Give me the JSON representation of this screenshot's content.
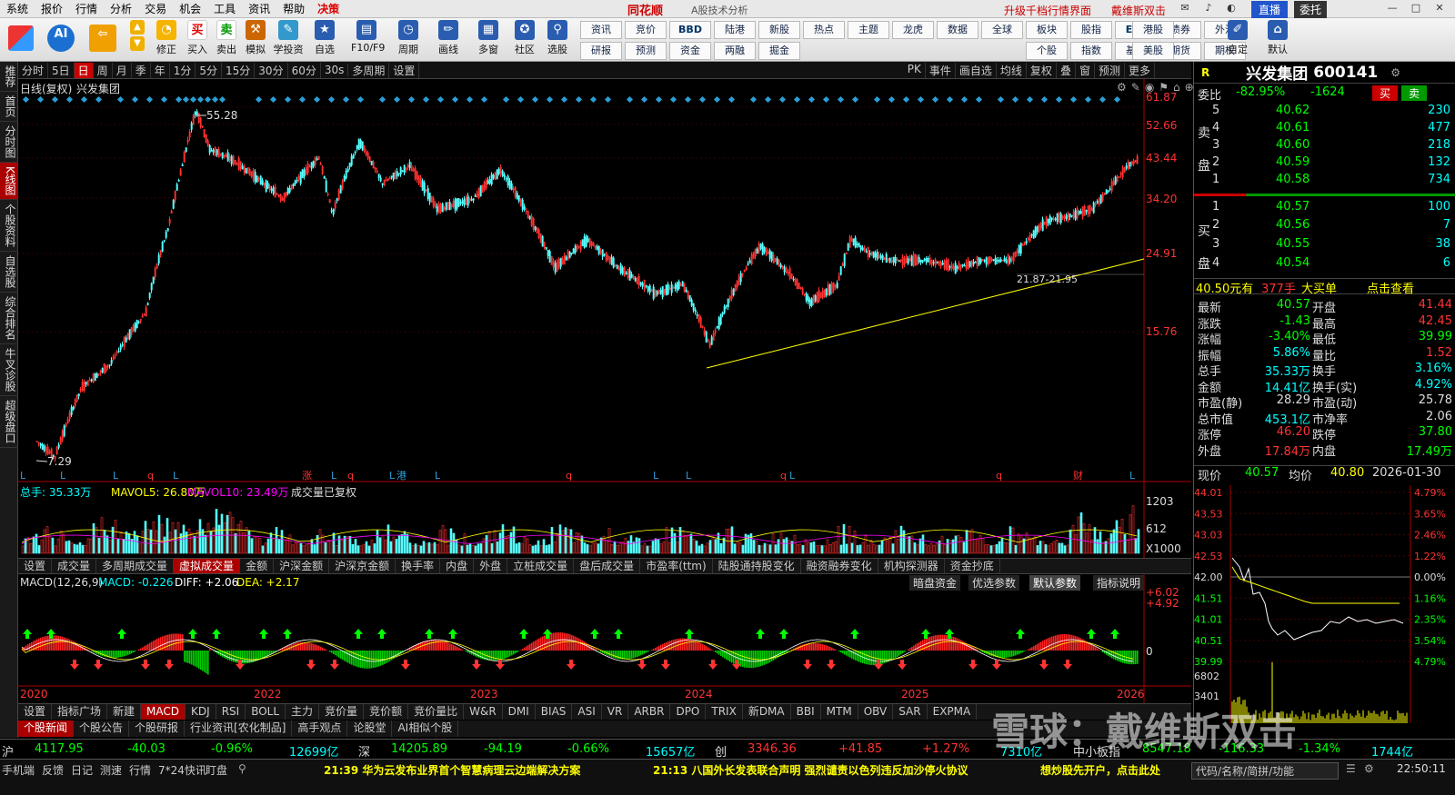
{
  "menu": [
    "系统",
    "报价",
    "行情",
    "分析",
    "交易",
    "机会",
    "工具",
    "资讯",
    "帮助",
    "决策"
  ],
  "app_title": "同花顺",
  "app_subtitle": "A股技术分析",
  "menu_right": {
    "upgrade": "升级千档行情界面",
    "user": "戴维斯双击",
    "zhibo": "直播",
    "weituo": "委托"
  },
  "toolbar_left": [
    "修正",
    "买入",
    "卖出",
    "模拟",
    "学投资",
    "自选",
    "F10/F9",
    "周期",
    "画线",
    "多窗",
    "社区",
    "选股"
  ],
  "toolbar_grid": [
    "资讯",
    "竞价",
    "BBD",
    "陆港",
    "新股",
    "热点",
    "主题",
    "龙虎",
    "数据",
    "全球",
    "板块",
    "股指",
    "ETF",
    "债券",
    "外汇",
    "港股",
    "自定",
    "默认",
    "研报",
    "预测",
    "资金",
    "两融",
    "掘金",
    "个股",
    "指数",
    "基金",
    "期货",
    "期权",
    "美股"
  ],
  "left_side": [
    "推荐",
    "首页",
    "分时图",
    "K线图",
    "个股资料",
    "自选股",
    "综合排名",
    "牛叉诊股",
    "超级盘口"
  ],
  "period_tabs": [
    "分时",
    "5日",
    "日",
    "周",
    "月",
    "季",
    "年",
    "1分",
    "5分",
    "15分",
    "30分",
    "60分",
    "30s",
    "多周期",
    "设置"
  ],
  "right_tabs": [
    "PK",
    "事件",
    "画自选",
    "均线",
    "复权",
    "叠",
    "窗",
    "预测",
    "更多"
  ],
  "chart_header": {
    "type": "日线(复权)",
    "name": "兴发集团"
  },
  "price_axis": [
    "61.87",
    "52.66",
    "43.44",
    "34.20",
    "24.91",
    "15.76"
  ],
  "annotations": {
    "high": "55.28",
    "low": "7.29",
    "range": "21.87-21.95"
  },
  "event_markers": [
    "L",
    "L",
    "L",
    "q",
    "L",
    "涨",
    "L",
    "q",
    "L",
    "港",
    "L",
    "q",
    "L",
    "L",
    "q",
    "L",
    "q",
    "财",
    "L"
  ],
  "volume_header": {
    "total": "总手: 35.33万",
    "mavol5": "MAVOL5: 26.80万",
    "mavol10": "MAVOL10: 23.49万",
    "note": "成交量已复权"
  },
  "volume_axis": [
    "1203",
    "612",
    "X1000"
  ],
  "ind_tabs": [
    "设置",
    "成交量",
    "多周期成交量",
    "虚拟成交量",
    "金额",
    "沪深金额",
    "沪深京金额",
    "换手率",
    "内盘",
    "外盘",
    "立桩成交量",
    "盘后成交量",
    "市盈率(ttm)",
    "陆股通持股变化",
    "融资融券变化",
    "机构探测器",
    "资金抄底"
  ],
  "macd_header": {
    "name": "MACD(12,26,9)",
    "macd": "MACD: -0.226",
    "diff": "DIFF: +2.06",
    "dea": "DEA: +2.17"
  },
  "macd_buttons": [
    "暗盘资金",
    "优选参数",
    "默认参数",
    "指标说明"
  ],
  "macd_axis": [
    "+6.02",
    "+4.92",
    "0"
  ],
  "years": [
    "2020",
    "2022",
    "2023",
    "2024",
    "2025",
    "2026"
  ],
  "ind_tabs2": [
    "设置",
    "指标广场",
    "新建",
    "MACD",
    "KDJ",
    "RSI",
    "BOLL",
    "主力",
    "竞价量",
    "竞价额",
    "竞价量比",
    "W&R",
    "DMI",
    "BIAS",
    "ASI",
    "VR",
    "ARBR",
    "DPO",
    "TRIX",
    "新DMA",
    "BBI",
    "MTM",
    "OBV",
    "SAR",
    "EXPMA"
  ],
  "news_tabs": [
    "个股新闻",
    "个股公告",
    "个股研报",
    "行业资讯[农化制品]",
    "高手观点",
    "论股堂",
    "AI相似个股"
  ],
  "stock": {
    "name": "兴发集团",
    "code": "600141",
    "weibi": "-82.95%",
    "weicha": "-1624",
    "buy_btn": "买",
    "sell_btn": "卖"
  },
  "asks": [
    {
      "lv": "5",
      "p": "40.62",
      "v": "230"
    },
    {
      "lv": "4",
      "p": "40.61",
      "v": "477"
    },
    {
      "lv": "3",
      "p": "40.60",
      "v": "218"
    },
    {
      "lv": "2",
      "p": "40.59",
      "v": "132"
    },
    {
      "lv": "1",
      "p": "40.58",
      "v": "734"
    }
  ],
  "bids": [
    {
      "lv": "1",
      "p": "40.57",
      "v": "100"
    },
    {
      "lv": "2",
      "p": "40.56",
      "v": "7"
    },
    {
      "lv": "3",
      "p": "40.55",
      "v": "38"
    },
    {
      "lv": "4",
      "p": "40.54",
      "v": "6"
    }
  ],
  "big_order": {
    "price": "40.50元有",
    "vol": "377手",
    "label": "大买单",
    "link": "点击查看"
  },
  "quote": [
    [
      "最新",
      "40.57",
      "开盘",
      "41.44"
    ],
    [
      "涨跌",
      "-1.43",
      "最高",
      "42.45"
    ],
    [
      "涨幅",
      "-3.40%",
      "最低",
      "39.99"
    ],
    [
      "振幅",
      "5.86%",
      "量比",
      "1.52"
    ],
    [
      "总手",
      "35.33万",
      "换手",
      "3.16%"
    ],
    [
      "金额",
      "14.41亿",
      "换手(实)",
      "4.92%"
    ],
    [
      "市盈(静)",
      "28.29",
      "市盈(动)",
      "25.78"
    ],
    [
      "总市值",
      "453.1亿",
      "市净率",
      "2.06"
    ],
    [
      "涨停",
      "46.20",
      "跌停",
      "37.80"
    ],
    [
      "外盘",
      "17.84万",
      "内盘",
      "17.49万"
    ]
  ],
  "intraday": {
    "now_label": "现价",
    "now": "40.57",
    "avg_label": "均价",
    "avg": "40.80",
    "date": "2026-01-30",
    "left_axis": [
      "44.01",
      "43.53",
      "43.03",
      "42.53",
      "42.00",
      "41.51",
      "41.01",
      "40.51",
      "39.99"
    ],
    "right_axis": [
      "4.79%",
      "3.65%",
      "2.46%",
      "1.22%",
      "0.00%",
      "1.16%",
      "2.35%",
      "3.54%",
      "4.79%"
    ],
    "vol_axis": [
      "6802",
      "3401"
    ]
  },
  "status": {
    "sh_label": "沪",
    "sh": "4117.95",
    "sh_chg": "-40.03",
    "sh_pct": "-0.96%",
    "sh_amt": "12699亿",
    "sz_label": "深",
    "sz": "14205.89",
    "sz_chg": "-94.19",
    "sz_pct": "-0.66%",
    "sz_amt": "15657亿",
    "cy_label": "创",
    "cy": "3346.36",
    "cy_chg": "+41.85",
    "cy_pct": "+1.27%",
    "cy_amt": "7310亿",
    "zx_label": "中小板指",
    "zx": "8547.18",
    "zx_chg": "-116.33",
    "zx_pct": "-1.34%",
    "zx_amt": "1744亿"
  },
  "bottom": {
    "tabs": [
      "手机端",
      "反馈",
      "日记",
      "测速",
      "行情",
      "7*24快讯",
      "盯盘"
    ],
    "news1": "21:39 华为云发布业界首个智慧病理云边端解决方案",
    "news2": "21:13 八国外长发表联合声明 强烈谴责以色列违反加沙停火协议",
    "news3": "想炒股先开户，点击此处",
    "search": "代码/名称/简拼/功能",
    "time": "22:50:11"
  },
  "watermark": "雪球：戴维斯双击",
  "colors": {
    "up": "#ff3232",
    "down": "#54ffff",
    "trend": "#ffff00",
    "bg": "#000000"
  }
}
